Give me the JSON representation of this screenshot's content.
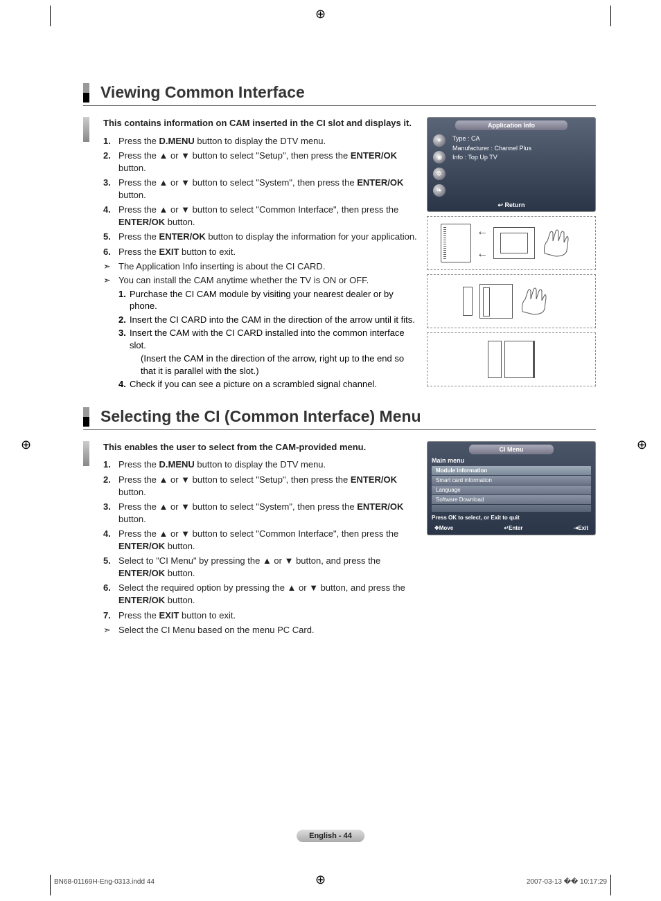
{
  "section1": {
    "title": "Viewing Common Interface",
    "intro": "This contains information on CAM inserted in the CI slot and displays it.",
    "steps": [
      {
        "n": "1.",
        "pre": "Press the ",
        "bold": "D.MENU",
        "post": " button to display the DTV menu."
      },
      {
        "n": "2.",
        "pre": "Press the ▲ or ▼ button to select \"Setup\", then press the ",
        "bold": "ENTER/OK",
        "post": " button."
      },
      {
        "n": "3.",
        "pre": "Press the ▲ or ▼ button to select \"System\", then press the ",
        "bold": "ENTER/OK",
        "post": " button."
      },
      {
        "n": "4.",
        "pre": "Press the ▲ or ▼ button to select \"Common Interface\", then press the ",
        "bold": "ENTER/OK",
        "post": " button."
      },
      {
        "n": "5.",
        "pre": "Press the ",
        "bold": "ENTER/OK",
        "post": " button to display the information for your application."
      },
      {
        "n": "6.",
        "pre": "Press the ",
        "bold": "EXIT",
        "post": " button to exit."
      }
    ],
    "notes": [
      "The Application Info inserting is about the CI CARD.",
      "You can install the CAM anytime whether the TV is ON or OFF."
    ],
    "substeps": [
      {
        "n": "1.",
        "t": "Purchase the CI CAM module by visiting your nearest dealer or by phone."
      },
      {
        "n": "2.",
        "t": "Insert the CI CARD into the CAM in the direction of the arrow until it fits."
      },
      {
        "n": "3.",
        "t": "Insert the CAM with the CI CARD installed into the common interface slot.",
        "extra": "(Insert the CAM in the direction of the arrow, right up to the end so that it is parallel with the slot.)"
      },
      {
        "n": "4.",
        "t": " Check if you can see a picture on a scrambled signal channel."
      }
    ],
    "tv": {
      "header": "Application Info",
      "line1": "Type : CA",
      "line2": "Manufacturer : Channel Plus",
      "line3": "Info : Top Up TV",
      "return": "Return"
    }
  },
  "section2": {
    "title": "Selecting the CI (Common Interface) Menu",
    "intro": "This enables the user to select from the CAM-provided menu.",
    "steps": [
      {
        "n": "1.",
        "pre": "Press the ",
        "bold": "D.MENU",
        "post": " button to display the DTV menu."
      },
      {
        "n": "2.",
        "pre": "Press the ▲ or ▼ button to select \"Setup\", then press the ",
        "bold": "ENTER/OK",
        "post": " button."
      },
      {
        "n": "3.",
        "pre": "Press the ▲ or ▼ button to select \"System\", then press the ",
        "bold": "ENTER/OK",
        "post": " button."
      },
      {
        "n": "4.",
        "pre": "Press the ▲ or ▼ button to select \"Common Interface\", then press the ",
        "bold": "ENTER/OK",
        "post": " button."
      },
      {
        "n": "5.",
        "pre": "Select to \"CI Menu\" by pressing the ▲ or ▼ button, and press the ",
        "bold": "ENTER/OK",
        "post": " button."
      },
      {
        "n": "6.",
        "pre": "Select the required option by pressing the ▲ or ▼ button, and press the ",
        "bold": "ENTER/OK",
        "post": " button."
      },
      {
        "n": "7.",
        "pre": "Press the ",
        "bold": "EXIT",
        "post": " button to exit."
      }
    ],
    "notes2": [
      "Select the CI Menu based on the menu PC Card."
    ],
    "ci": {
      "header": "CI Menu",
      "main": "Main menu",
      "items": [
        "Module information",
        "Smart card information",
        "Language",
        "Software Download"
      ],
      "hint": "Press OK to select, or Exit to quit",
      "move": "Move",
      "enter": "Enter",
      "exit": "Exit"
    }
  },
  "pageLabel": "English - 44",
  "footerLeft": "BN68-01169H-Eng-0313.indd   44",
  "footerRight": "2007-03-13   �� 10:17:29",
  "glyph": {
    "reg": "⊕",
    "ret": "↩",
    "move": "✥",
    "enter": "↵",
    "exit": "⇥",
    "arrow": "➣"
  }
}
